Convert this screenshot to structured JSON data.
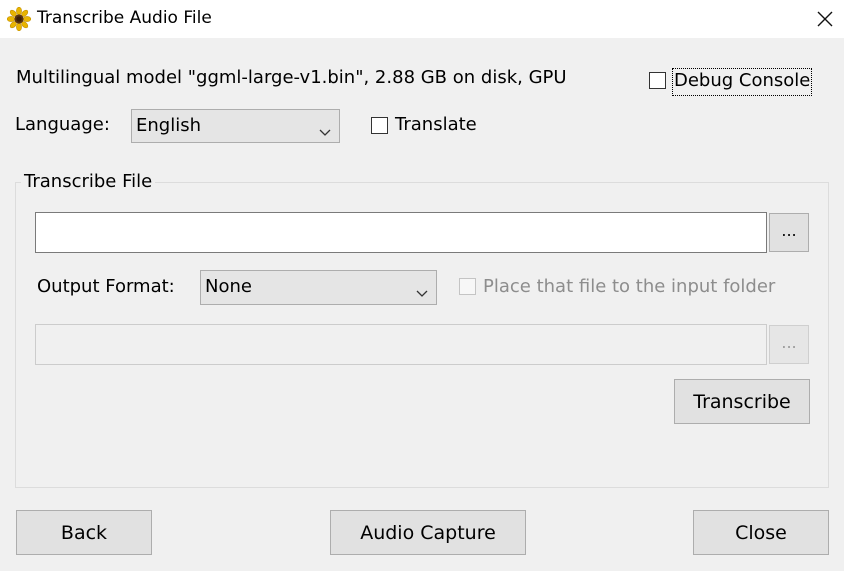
{
  "window": {
    "title": "Transcribe Audio File",
    "app_icon": "sunflower-icon",
    "close_icon": "close-icon"
  },
  "model_info": "Multilingual model \"ggml-large-v1.bin\", 2.88 GB on disk, GPU",
  "debug_console": {
    "label": "Debug Console",
    "checked": false
  },
  "language": {
    "label": "Language:",
    "value": "English"
  },
  "translate": {
    "label": "Translate",
    "checked": false
  },
  "transcribe_file": {
    "group_title": "Transcribe File",
    "input_value": "",
    "browse_label": "...",
    "output_format": {
      "label": "Output Format:",
      "value": "None"
    },
    "place_in_input_folder": {
      "label": "Place that file to the input folder",
      "checked": false,
      "enabled": false
    },
    "output_value": "",
    "output_browse_label": "...",
    "transcribe_button": "Transcribe"
  },
  "footer": {
    "back_label": "Back",
    "audio_capture_label": "Audio Capture",
    "close_label": "Close"
  },
  "colors": {
    "window_bg": "#f0f0f0",
    "titlebar_bg": "#ffffff",
    "button_bg": "#e1e1e1",
    "disabled_text": "#8d8d8d"
  }
}
